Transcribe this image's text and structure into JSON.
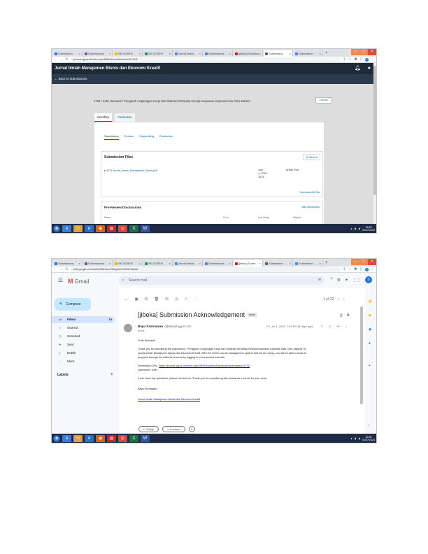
{
  "screenshot1": {
    "tabs": [
      {
        "label": "Submission",
        "color": "#1a73e8"
      },
      {
        "label": "Submissions",
        "color": "#8e44ad"
      },
      {
        "label": "SK DOSEN",
        "color": "#f4b400"
      },
      {
        "label": "SK DOSEN",
        "color": "#0f9d58"
      },
      {
        "label": "Jurnal Ilmiah",
        "color": "#4285f4"
      },
      {
        "label": "Submissions",
        "color": "#4285f4"
      },
      {
        "label": "[jibeka] Submission",
        "color": "#c5221f"
      },
      {
        "label": "Submission",
        "color": "#5f6368"
      },
      {
        "label": "Submission",
        "color": "#4285f4"
      }
    ],
    "url": "journal.ugj.ac.id/index.php/JIBEKA/workflow/index/1732/1",
    "header_title": "Jurnal Ilmiah Manajemen Bisnis dan Ekonomi Kreatif",
    "subheader": "Back to Submissions",
    "submission_title": "1732 / Sutin Stewanti / Pengaruh Lingkungan Kerja dan Motivasi Terhadap Kinerja Karyawan Koperasi Asia Citra Jakarta",
    "library_label": "Library",
    "main_tabs": [
      "Workflow",
      "Publication"
    ],
    "stage_tabs": [
      "Submission",
      "Review",
      "Copyediting",
      "Production"
    ],
    "submission_files_heading": "Submission Files",
    "search_label": "Q Search",
    "file": {
      "name": "4231 Jurnal_Ilmiah_Manajemen_Bisnis.pdf",
      "date_line1": "July",
      "date_line2": "1, 2024",
      "date_line3": "2024",
      "type": "Article Text"
    },
    "download_all": "Download All Files",
    "prereview_heading": "Pre-Review Discussions",
    "add_discussion": "Add discussion",
    "prereview_cols": [
      "Name",
      "From",
      "Last Reply",
      "Replies"
    ],
    "taskbar_time": "16:45",
    "taskbar_date": "01/07/2024"
  },
  "screenshot2": {
    "tabs": [
      {
        "label": "Submissions",
        "color": "#1a73e8"
      },
      {
        "label": "Submissions",
        "color": "#8e44ad"
      },
      {
        "label": "SK DOSEN",
        "color": "#f4b400"
      },
      {
        "label": "SK DOSEN",
        "color": "#0f9d58"
      },
      {
        "label": "Jurnal Ilmiah",
        "color": "#4285f4"
      },
      {
        "label": "Submissions",
        "color": "#4285f4"
      },
      {
        "label": "[jibeka] Subm",
        "color": "#c5221f"
      },
      {
        "label": "Submission",
        "color": "#5f6368"
      },
      {
        "label": "Submission",
        "color": "#4285f4"
      }
    ],
    "url": "mail.google.com/mail/u/0/#inbox/FMfcgzQVxRbMZJdbpwt",
    "app_name": "Gmail",
    "search_placeholder": "Search mail",
    "compose_label": "Compose",
    "nav": [
      {
        "icon": "▭",
        "label": "Inbox",
        "count": "18",
        "active": true
      },
      {
        "icon": "☆",
        "label": "Starred",
        "count": "",
        "active": false
      },
      {
        "icon": "◷",
        "label": "Snoozed",
        "count": "",
        "active": false
      },
      {
        "icon": "➤",
        "label": "Sent",
        "count": "",
        "active": false
      },
      {
        "icon": "▯",
        "label": "Drafts",
        "count": "",
        "active": false
      },
      {
        "icon": "⌄",
        "label": "More",
        "count": "",
        "active": false
      }
    ],
    "labels_heading": "Labels",
    "pager_text": "1 of 22",
    "subject": "[jibeka] Submission Acknowledgement",
    "inbox_chip": "Inbox",
    "sender_name": "Bayu Kurniawan",
    "sender_email": "<jibeka@ugj.ac.id>",
    "to_line": "to me",
    "date": "Fri, Jul 1, 2024, 2:36 PM (3 days ago)",
    "body": {
      "greeting": "Sutin Stewanti:",
      "line1": "Thank you for submitting the manuscript, \"Pengaruh Lingkungan Kerja dan Motivasi Terhadap Kinerja Karyawan Koperasi Asia Citra Jakarta\" to",
      "line2": "Jurnal Ilmiah Manajemen Bisnis dan Ekonomi Kreatif. With the online journal management system that we are using, you will be able to track its",
      "line3": "progress through the editorial process by logging in to the journal web site:",
      "url_label": "Submission URL:",
      "url": "https://journal.ugj.ac.id/index.php/JIBEKA/authorDashboard/submission/1732",
      "username": "Username: sutin",
      "questions": "If you have any questions, please contact me. Thank you for considering this journal as a venue for your work.",
      "signoff": "Bayu Kurniawan",
      "signature": "Jurnal Ilmiah Manajemen Bisnis dan Ekonomi Kreatif"
    },
    "reply_label": "Reply",
    "forward_label": "Forward",
    "taskbar_time": "16:45",
    "taskbar_date": "01/07/2024"
  }
}
